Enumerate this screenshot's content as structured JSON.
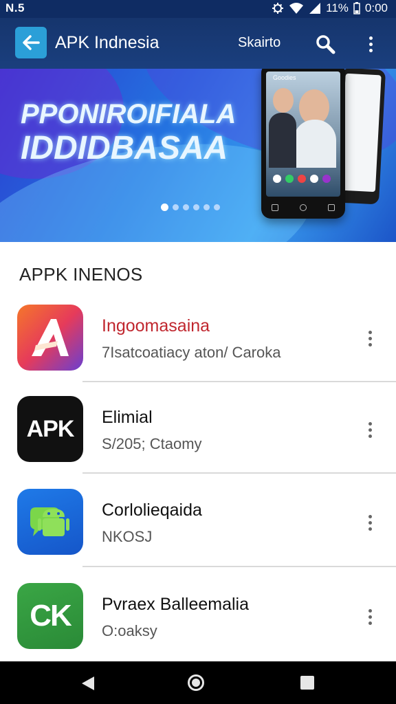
{
  "status_bar": {
    "left_text": "N.5",
    "battery": "11%",
    "time": "0:00"
  },
  "app_bar": {
    "title": "APK Indnesia",
    "share_label": "Skairto"
  },
  "banner": {
    "headline_line1": "PPONIROIFIALA",
    "headline_line2": "IDDIDBASAA",
    "slide_count": 6,
    "active_slide": 1,
    "screen_text": "Goodies"
  },
  "section": {
    "title": "APPK INENOS"
  },
  "apps": [
    {
      "name": "Ingoomasaina",
      "subtitle": "7Isatcoatiacy  aton/ Caroka",
      "name_color": "#c0262e",
      "icon_text": ""
    },
    {
      "name": "Elimial",
      "subtitle": "S/205; Ctaomy",
      "name_color": "#111111",
      "icon_text": "APK"
    },
    {
      "name": "Corlolieqaida",
      "subtitle": "NKOSJ",
      "name_color": "#111111",
      "icon_text": ""
    },
    {
      "name": "Pvraex Balleemalia",
      "subtitle": "O:oaksy",
      "name_color": "#111111",
      "icon_text": "CK"
    }
  ],
  "icons": [
    "back-arrow-icon",
    "search-icon",
    "more-vert-icon",
    "wifi-icon",
    "signal-icon",
    "battery-icon",
    "nav-back-icon",
    "nav-home-icon",
    "nav-recents-icon"
  ]
}
